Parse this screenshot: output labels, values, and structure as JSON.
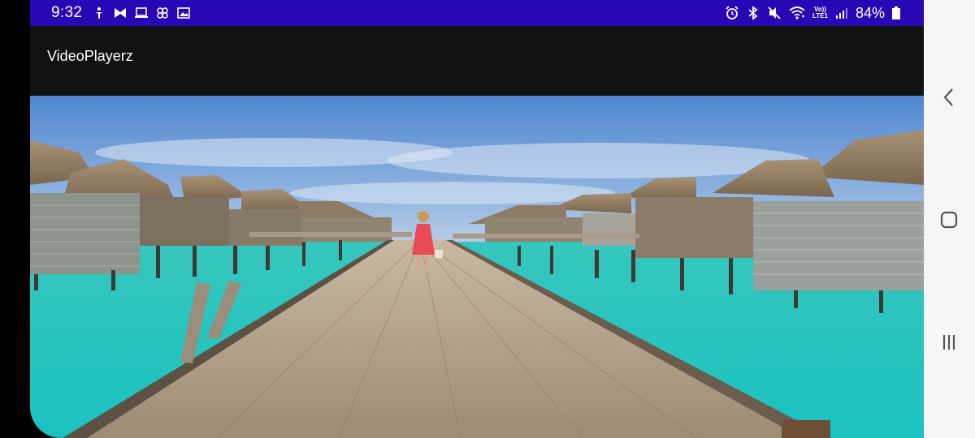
{
  "status_bar": {
    "time": "9:32",
    "battery_percent": "84%",
    "network_label": "LTE1",
    "volte_label": "Vo))",
    "background_color": "#2a07b5",
    "left_icons": [
      "accessibility-icon",
      "bowtie-icon",
      "laptop-icon",
      "pinwheel-icon",
      "image-icon"
    ],
    "right_icons": [
      "alarm-icon",
      "bluetooth-icon",
      "mute-icon",
      "wifi-icon",
      "signal-icon",
      "battery-icon"
    ]
  },
  "app_bar": {
    "title": "VideoPlayerz",
    "background_color": "#111111"
  },
  "video": {
    "description_icon": "video-frame",
    "scene": "overwater-bungalows-boardwalk"
  },
  "nav_bar": {
    "buttons": [
      "back-icon",
      "home-icon",
      "recents-icon"
    ]
  }
}
